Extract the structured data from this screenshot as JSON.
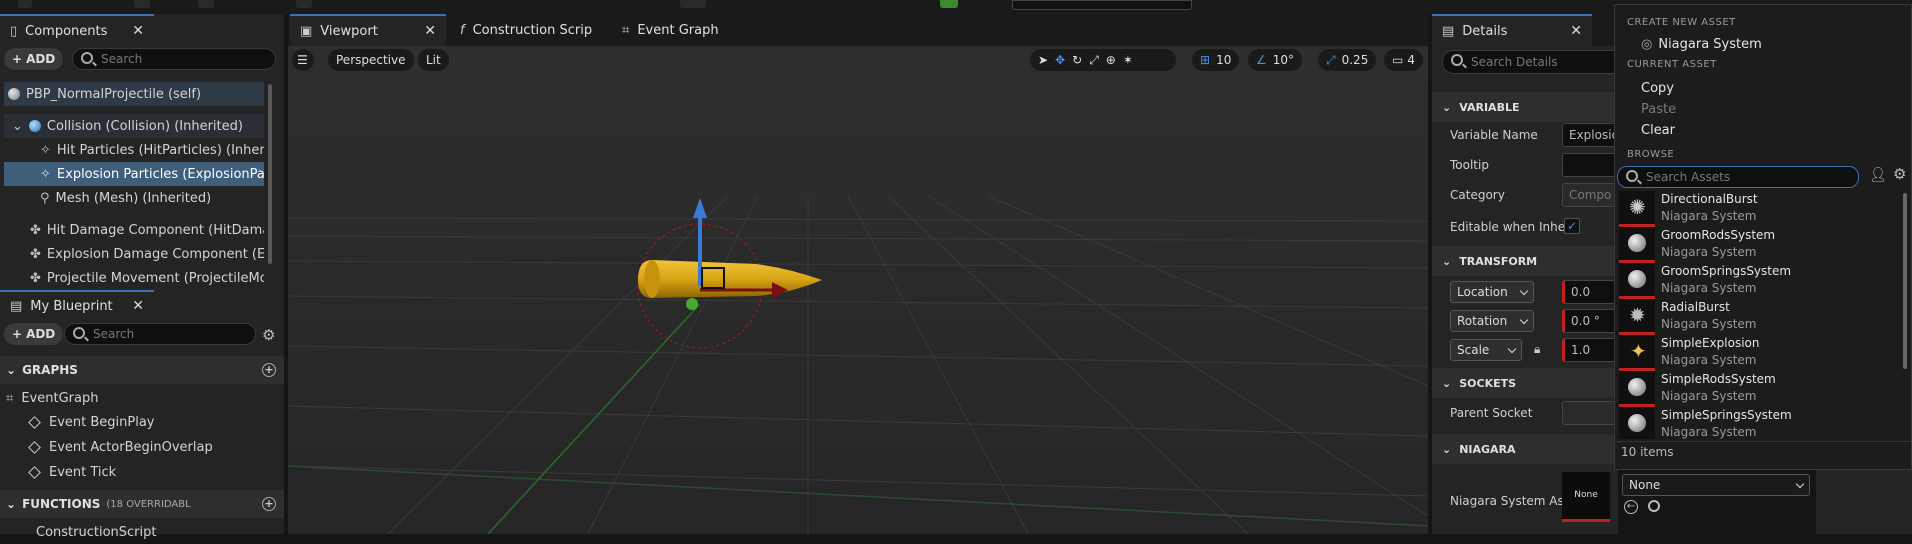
{
  "tabs": {
    "components": "Components",
    "viewport": "Viewport",
    "construction": "Construction Scrip",
    "event_graph": "Event Graph",
    "my_blueprint": "My Blueprint",
    "details": "Details"
  },
  "components": {
    "add_label": "ADD",
    "search_placeholder": "Search",
    "items": [
      {
        "label": "PBP_NormalProjectile (self)"
      },
      {
        "label": "Collision (Collision) (Inherited)"
      },
      {
        "label": "Hit Particles (HitParticles) (Inherited)"
      },
      {
        "label": "Explosion Particles (ExplosionParticles)"
      },
      {
        "label": "Mesh (Mesh) (Inherited)"
      },
      {
        "label": "Hit Damage Component (HitDamageComponent)"
      },
      {
        "label": "Explosion Damage Component (ExplosionDamage)"
      },
      {
        "label": "Projectile Movement (ProjectileMovement)"
      }
    ]
  },
  "my_blueprint": {
    "add_label": "ADD",
    "search_placeholder": "Search",
    "graphs_header": "GRAPHS",
    "event_graph": "EventGraph",
    "events": [
      "Event BeginPlay",
      "Event ActorBeginOverlap",
      "Event Tick"
    ],
    "functions_header": "FUNCTIONS",
    "functions_count": "(18 OVERRIDABL",
    "construction_script": "ConstructionScript"
  },
  "viewport": {
    "perspective": "Perspective",
    "lit": "Lit",
    "grid_snap": "10",
    "rot_snap": "10°",
    "scale_snap": "0.25",
    "camera_speed": "4"
  },
  "details": {
    "search_placeholder": "Search Details",
    "variable_header": "VARIABLE",
    "variable_name_label": "Variable Name",
    "variable_name_value": "Explosio",
    "tooltip_label": "Tooltip",
    "category_label": "Category",
    "category_value": "Compo",
    "editable_label": "Editable when Inher",
    "transform_header": "TRANSFORM",
    "location_label": "Location",
    "location_value": "0.0",
    "rotation_label": "Rotation",
    "rotation_value": "0.0 °",
    "scale_label": "Scale",
    "scale_value": "1.0",
    "sockets_header": "SOCKETS",
    "parent_socket_label": "Parent Socket",
    "niagara_header": "NIAGARA",
    "niagara_asset_label": "Niagara System As",
    "none_thumb": "None"
  },
  "asset_picker": {
    "create_header": "CREATE NEW ASSET",
    "create_item": "Niagara System",
    "current_header": "CURRENT ASSET",
    "copy": "Copy",
    "paste": "Paste",
    "clear": "Clear",
    "browse_header": "BROWSE",
    "search_placeholder": "Search Assets",
    "assets": [
      {
        "name": "DirectionalBurst",
        "type": "Niagara System"
      },
      {
        "name": "GroomRodsSystem",
        "type": "Niagara System"
      },
      {
        "name": "GroomSpringsSystem",
        "type": "Niagara System"
      },
      {
        "name": "RadialBurst",
        "type": "Niagara System"
      },
      {
        "name": "SimpleExplosion",
        "type": "Niagara System"
      },
      {
        "name": "SimpleRodsSystem",
        "type": "Niagara System"
      },
      {
        "name": "SimpleSpringsSystem",
        "type": "Niagara System"
      }
    ],
    "item_count": "10 items",
    "dropdown_value": "None"
  },
  "colors": {
    "accent_blue": "#3d6fb5",
    "selected_row": "#3e5e7a",
    "projectile_gold": "#d9a514",
    "checkbox_blue": "#2a6fd6"
  }
}
